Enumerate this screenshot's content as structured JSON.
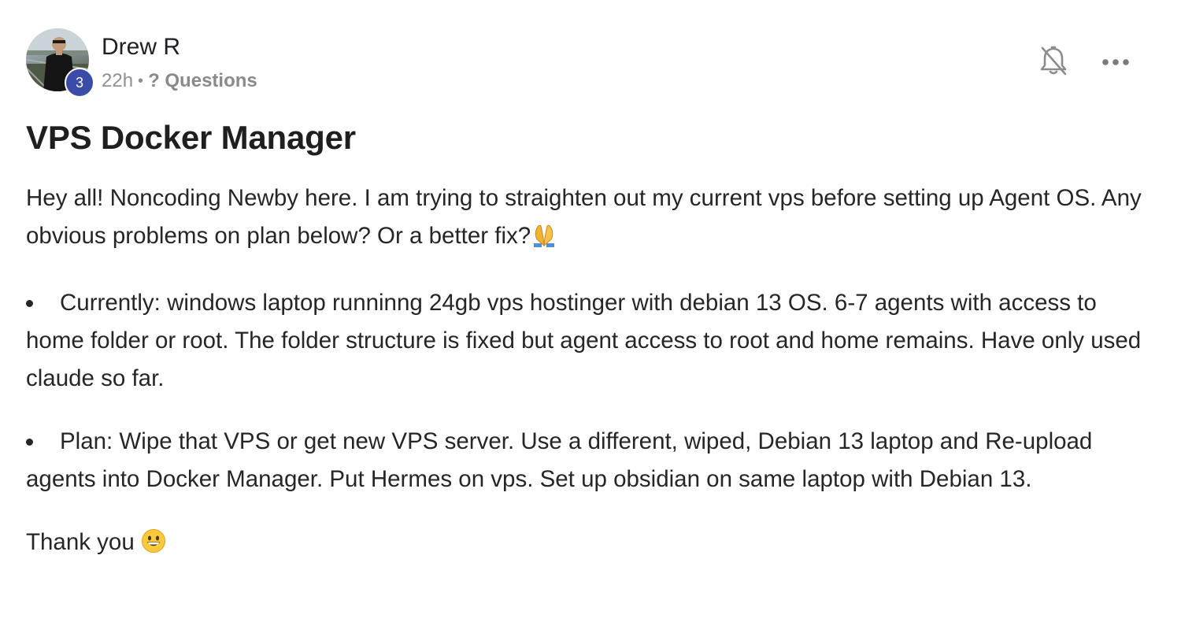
{
  "post": {
    "author": {
      "name": "Drew R",
      "level": "3"
    },
    "time_ago": "22h",
    "separator": "•",
    "category": "? Questions",
    "title": "VPS Docker Manager",
    "intro": "Hey all! Noncoding Newby here. I am trying to straighten out my current vps before setting up Agent OS. Any obvious problems on plan below? Or a better fix?",
    "bullets": [
      "Currently: windows laptop runninng 24gb vps hostinger with debian 13 OS. 6-7 agents with access to home folder or root. The folder structure is fixed but agent access to root and home remains. Have only used claude so far.",
      "Plan: Wipe that VPS or get new VPS server. Use a different, wiped, Debian 13 laptop and Re-upload agents into Docker Manager. Put Hermes on vps. Set up obsidian on same laptop with Debian 13."
    ],
    "closing": "Thank you"
  },
  "icons": {
    "notification": "bell-off-icon",
    "more": "more-horizontal-icon",
    "intro_emoji": "folded-hands-emoji",
    "closing_emoji": "grinning-face-emoji"
  },
  "colors": {
    "badge": "#3b4ba8",
    "meta_text": "#909090",
    "icon_gray": "#8c8c8c"
  }
}
